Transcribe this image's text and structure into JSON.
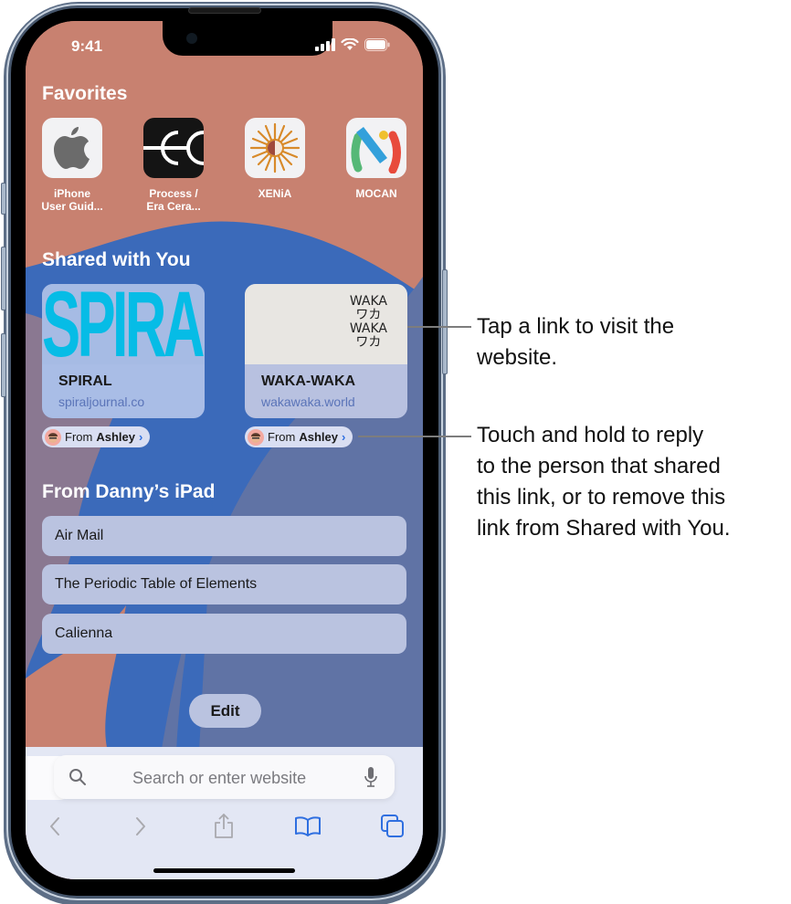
{
  "status_bar": {
    "time": "9:41"
  },
  "favorites": {
    "title": "Favorites",
    "items": [
      {
        "label_line1": "iPhone",
        "label_line2": "User Guid...",
        "icon": "apple-logo-icon"
      },
      {
        "label_line1": "Process /",
        "label_line2": "Era Cera...",
        "icon": "ec-logo-icon"
      },
      {
        "label_line1": "XENiA",
        "label_line2": "",
        "icon": "xenia-sun-icon"
      },
      {
        "label_line1": "MOCAN",
        "label_line2": "",
        "icon": "mocan-m-icon"
      }
    ]
  },
  "shared_with_you": {
    "title": "Shared with You",
    "cards": [
      {
        "thumb_text": "SPIRAL",
        "title": "SPIRAL",
        "url": "spiraljournal.co",
        "from_prefix": "From",
        "from_name": "Ashley"
      },
      {
        "thumb_lines": [
          "WAKA",
          "ワカ",
          "WAKA",
          "ワカ"
        ],
        "title": "WAKA-WAKA",
        "url": "wakawaka.world",
        "from_prefix": "From",
        "from_name": "Ashley"
      }
    ]
  },
  "from_ipad": {
    "title": "From Danny’s iPad",
    "items": [
      "Air Mail",
      "The Periodic Table of Elements",
      "Calienna"
    ]
  },
  "edit_label": "Edit",
  "search": {
    "placeholder": "Search or enter website"
  },
  "toolbar": {
    "icons": [
      "back-icon",
      "forward-icon",
      "share-icon",
      "bookmarks-icon",
      "tabs-icon"
    ]
  },
  "callouts": [
    {
      "lines": [
        "Tap a link to visit the",
        "website."
      ]
    },
    {
      "lines": [
        "Touch and hold to reply",
        "to the person that shared",
        "this link, or to remove this",
        "link from Shared with You."
      ]
    }
  ],
  "colors": {
    "screen_bg": "#c88170",
    "blue_shape": "#3b6aba",
    "slate_shape": "#6073a5",
    "accent_blue": "#2f6fe0",
    "spiral_cyan": "#06bce6"
  }
}
